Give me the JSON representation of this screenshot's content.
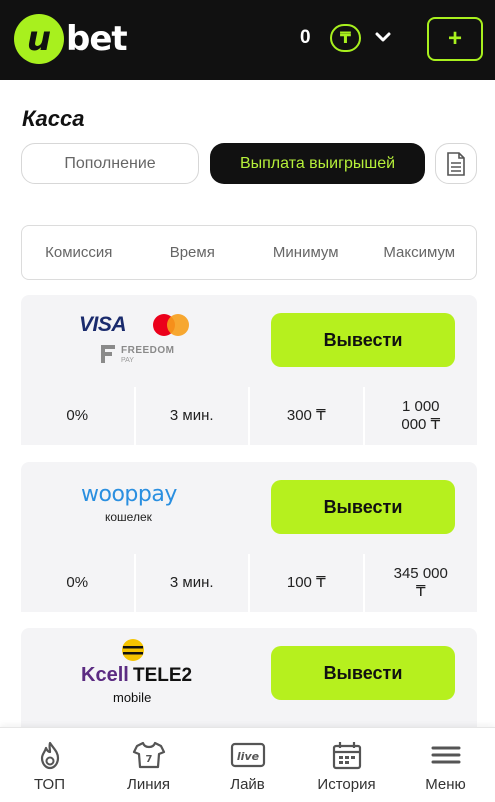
{
  "header": {
    "logo_letter": "u",
    "logo_text": "bet",
    "balance": "0",
    "currency_symbol": "₸",
    "add_label": "+"
  },
  "page": {
    "title": "Касса",
    "tabs": [
      {
        "label": "Пополнение",
        "active": false
      },
      {
        "label": "Выплата выигрышей",
        "active": true
      }
    ]
  },
  "columns": [
    "Комиссия",
    "Время",
    "Минимум",
    "Максимум"
  ],
  "methods": [
    {
      "logos": [
        "VISA",
        "mastercard",
        "FREEDOM",
        "PAY"
      ],
      "button_label": "Вывести",
      "commission": "0%",
      "time": "3 мин.",
      "minimum": "300 ₸",
      "maximum_line1": "1 000",
      "maximum_line2": "000 ₸"
    },
    {
      "logos": [
        "wooppay",
        "кошелек"
      ],
      "button_label": "Вывести",
      "commission": "0%",
      "time": "3 мин.",
      "minimum": "100 ₸",
      "maximum_line1": "345 000",
      "maximum_line2": "₸"
    },
    {
      "logos": [
        "Kcell",
        "TELE2",
        "mobile"
      ],
      "button_label": "Вывести"
    }
  ],
  "bottom_nav": [
    {
      "label": "ТОП",
      "icon": "flame-icon"
    },
    {
      "label": "Линия",
      "icon": "jersey-icon"
    },
    {
      "label": "Лайв",
      "icon": "live-icon",
      "badge": "live"
    },
    {
      "label": "История",
      "icon": "calendar-icon"
    },
    {
      "label": "Меню",
      "icon": "menu-icon"
    }
  ],
  "colors": {
    "accent": "#b6f01e",
    "header_bg": "#111111",
    "card_bg": "#f4f4f6"
  }
}
